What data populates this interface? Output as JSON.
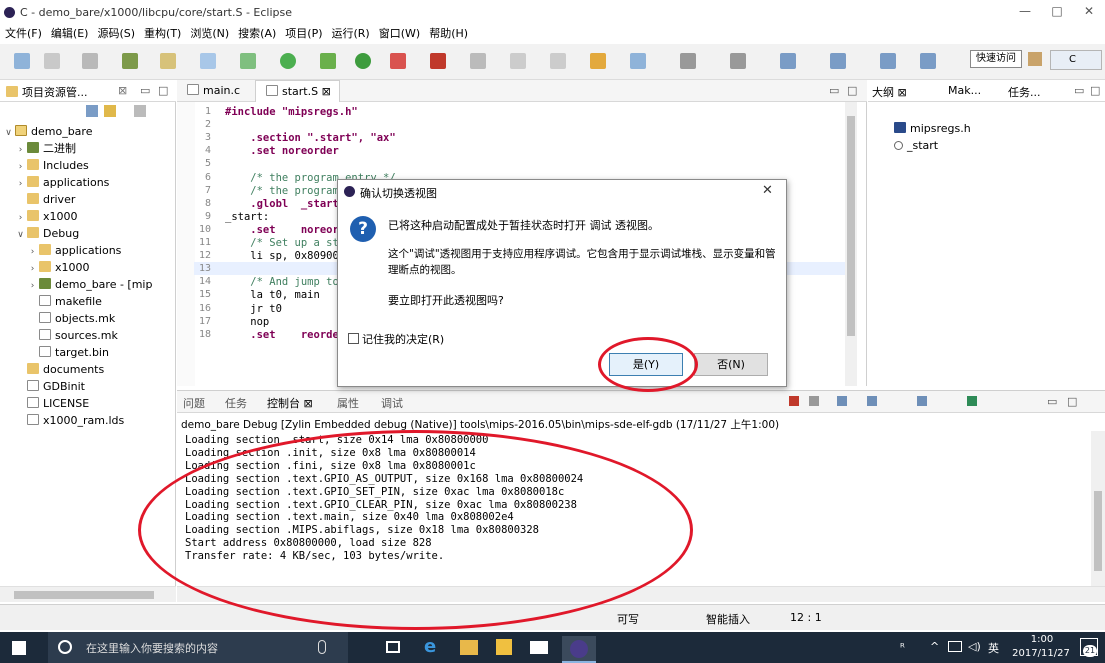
{
  "window": {
    "title": "C - demo_bare/x1000/libcpu/core/start.S - Eclipse",
    "minimize": "—",
    "maximize": "□",
    "close": "✕"
  },
  "menu": [
    "文件(F)",
    "编辑(E)",
    "源码(S)",
    "重构(T)",
    "浏览(N)",
    "搜索(A)",
    "项目(P)",
    "运行(R)",
    "窗口(W)",
    "帮助(H)"
  ],
  "toolbar": {
    "quick_access": "快速访问",
    "c_perspective": "C"
  },
  "explorer": {
    "tab_title": "项目资源管...",
    "tab_close": "⊠",
    "items": [
      {
        "label": "demo_bare",
        "kind": "proj",
        "indent": 0,
        "twisty": "v"
      },
      {
        "label": "二进制",
        "kind": "bin",
        "indent": 1,
        "twisty": ">"
      },
      {
        "label": "Includes",
        "kind": "folder",
        "indent": 1,
        "twisty": ">"
      },
      {
        "label": "applications",
        "kind": "folder",
        "indent": 1,
        "twisty": ">"
      },
      {
        "label": "driver",
        "kind": "folder",
        "indent": 1,
        "twisty": ""
      },
      {
        "label": "x1000",
        "kind": "folder",
        "indent": 1,
        "twisty": ">"
      },
      {
        "label": "Debug",
        "kind": "folder",
        "indent": 1,
        "twisty": "v"
      },
      {
        "label": "applications",
        "kind": "folder",
        "indent": 2,
        "twisty": ">"
      },
      {
        "label": "x1000",
        "kind": "folder",
        "indent": 2,
        "twisty": ">"
      },
      {
        "label": "demo_bare - [mip",
        "kind": "bin",
        "indent": 2,
        "twisty": ">"
      },
      {
        "label": "makefile",
        "kind": "file",
        "indent": 2,
        "twisty": ""
      },
      {
        "label": "objects.mk",
        "kind": "file",
        "indent": 2,
        "twisty": ""
      },
      {
        "label": "sources.mk",
        "kind": "file",
        "indent": 2,
        "twisty": ""
      },
      {
        "label": "target.bin",
        "kind": "file",
        "indent": 2,
        "twisty": ""
      },
      {
        "label": "documents",
        "kind": "folder",
        "indent": 1,
        "twisty": ""
      },
      {
        "label": "GDBinit",
        "kind": "file",
        "indent": 1,
        "twisty": ""
      },
      {
        "label": "LICENSE",
        "kind": "file",
        "indent": 1,
        "twisty": ""
      },
      {
        "label": "x1000_ram.lds",
        "kind": "file",
        "indent": 1,
        "twisty": ""
      }
    ]
  },
  "editor": {
    "tabs": [
      {
        "label": "main.c",
        "active": false
      },
      {
        "label": "start.S ⊠",
        "active": true
      }
    ],
    "lines": [
      {
        "n": "1",
        "text": "#include \"mipsregs.h\""
      },
      {
        "n": "2",
        "text": ""
      },
      {
        "n": "3",
        "text": "    .section \".start\", \"ax\""
      },
      {
        "n": "4",
        "text": "    .set noreorder"
      },
      {
        "n": "5",
        "text": ""
      },
      {
        "n": "6",
        "text": "    /* the program entry */"
      },
      {
        "n": "7",
        "text": "    /* the program"
      },
      {
        "n": "8",
        "text": "    .globl  _start"
      },
      {
        "n": "9",
        "text": "_start:"
      },
      {
        "n": "10",
        "text": "    .set    noreord"
      },
      {
        "n": "11",
        "text": "    /* Set up a sta"
      },
      {
        "n": "12",
        "text": "    li sp, 0x809000"
      },
      {
        "n": "13",
        "text": ""
      },
      {
        "n": "14",
        "text": "    /* And jump to"
      },
      {
        "n": "15",
        "text": "    la t0, main"
      },
      {
        "n": "16",
        "text": "    jr t0"
      },
      {
        "n": "17",
        "text": "    nop"
      },
      {
        "n": "18",
        "text": "    .set    reorder"
      }
    ]
  },
  "outline": {
    "tabs": [
      "大纲 ⊠",
      "Mak...",
      "任务..."
    ],
    "items": [
      "mipsregs.h",
      "_start"
    ]
  },
  "console": {
    "tabs": [
      "问题",
      "任务",
      "控制台 ⊠",
      "属性",
      "调试"
    ],
    "header": "demo_bare Debug [Zylin Embedded debug (Native)] tools\\mips-2016.05\\bin\\mips-sde-elf-gdb (17/11/27 上午1:00)",
    "lines": [
      "Loading section .start, size 0x14 lma 0x80800000",
      "Loading section .init, size 0x8 lma 0x80800014",
      "Loading section .fini, size 0x8 lma 0x8080001c",
      "Loading section .text.GPIO_AS_OUTPUT, size 0x168 lma 0x80800024",
      "Loading section .text.GPIO_SET_PIN, size 0xac lma 0x8080018c",
      "Loading section .text.GPIO_CLEAR_PIN, size 0xac lma 0x80800238",
      "Loading section .text.main, size 0x40 lma 0x808002e4",
      "Loading section .MIPS.abiflags, size 0x18 lma 0x80800328",
      "Start address 0x80800000, load size 828",
      "Transfer rate: 4 KB/sec, 103 bytes/write."
    ]
  },
  "dialog": {
    "title": "确认切换透视图",
    "line1": "已将这种启动配置成处于暂挂状态时打开 调试 透视图。",
    "line2a": "这个\"调试\"透视图用于支持应用程序调试。它包含用于显示调试堆栈、显示变量和管",
    "line2b": "理断点的视图。",
    "question": "要立即打开此透视图吗?",
    "remember": "记住我的决定(R)",
    "yes": "是(Y)",
    "no": "否(N)",
    "close": "✕"
  },
  "status": {
    "writable": "可写",
    "insert": "智能插入",
    "position": "12 : 1"
  },
  "taskbar": {
    "search_placeholder": "在这里输入你要搜索的内容",
    "ime": "英",
    "time": "1:00",
    "date": "2017/11/27",
    "notify_count": "21"
  },
  "colors": {
    "annotation_red": "#e0182a",
    "taskbar": "#1c2a3a",
    "dialog_question": "#1f5fb0"
  }
}
